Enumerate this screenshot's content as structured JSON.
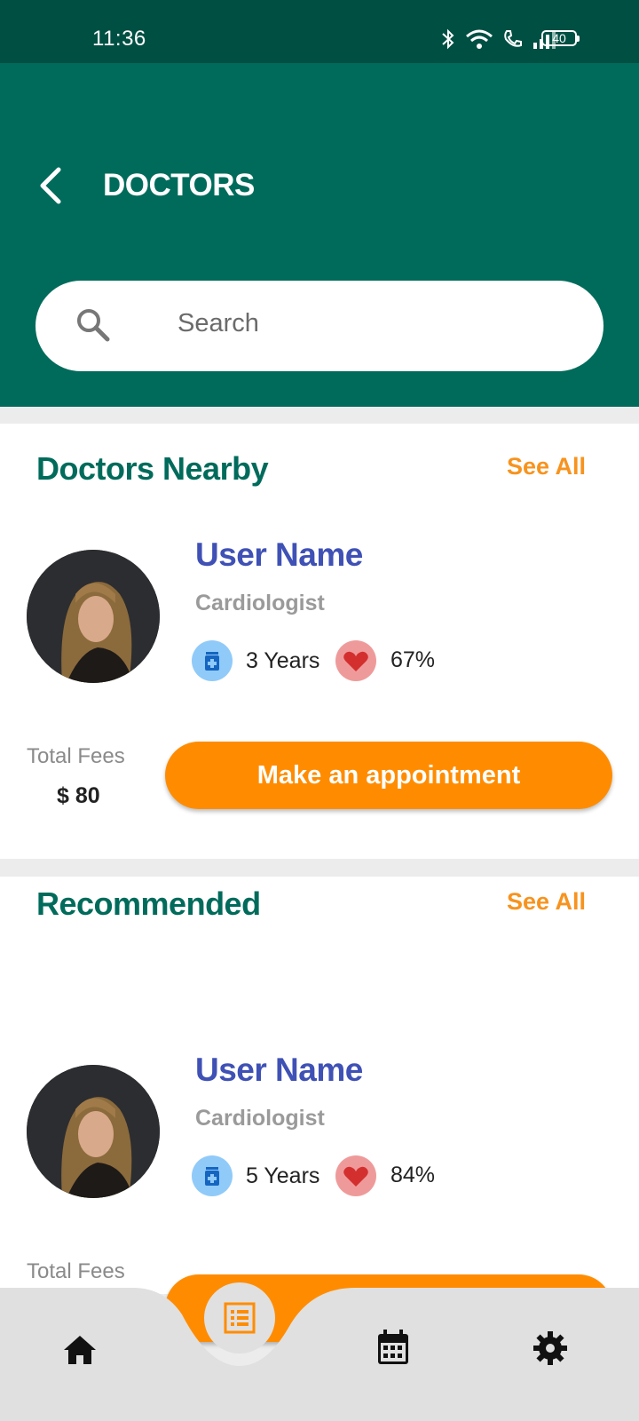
{
  "status": {
    "time": "11:36",
    "battery": "40"
  },
  "header": {
    "title": "DOCTORS"
  },
  "search": {
    "placeholder": "Search"
  },
  "sections": [
    {
      "title": "Doctors Nearby",
      "see_all": "See All",
      "doctor": {
        "name": "User Name",
        "specialty": "Cardiologist",
        "experience": "3 Years",
        "rating": "67%",
        "fees_label": "Total Fees",
        "fees": "$ 80",
        "button": "Make an appointment"
      }
    },
    {
      "title": "Recommended",
      "see_all": "See All",
      "doctor": {
        "name": "User Name",
        "specialty": "Cardiologist",
        "experience": "5 Years",
        "rating": "84%",
        "fees_label": "Total Fees",
        "button": ""
      }
    }
  ],
  "nav": {
    "items": [
      "home-icon",
      "list-icon",
      "calendar-icon",
      "settings-icon"
    ],
    "active": "list-icon"
  },
  "colors": {
    "primary": "#006b5b",
    "accent": "#ff8c00",
    "name": "#3f51b5"
  }
}
